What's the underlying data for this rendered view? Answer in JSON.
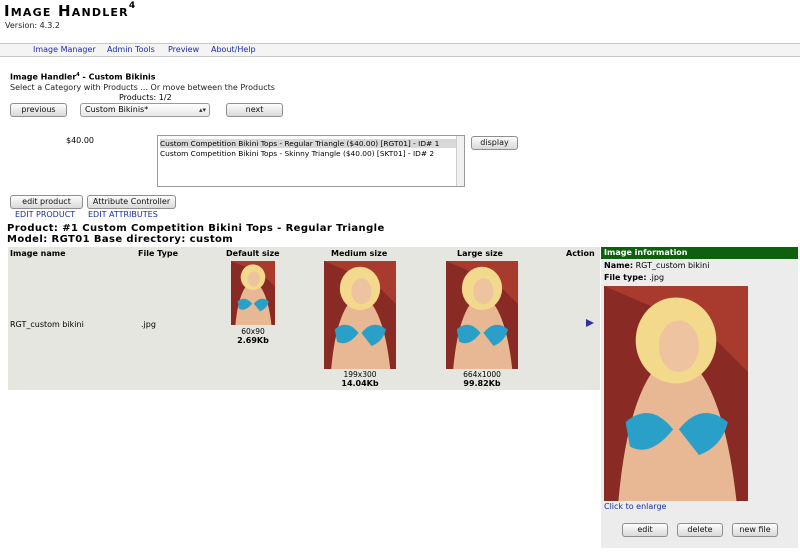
{
  "app": {
    "name": "Image Handler",
    "name_sup": "4",
    "version": "Version: 4.3.2"
  },
  "nav": [
    "Image Manager",
    "Admin Tools",
    "Preview",
    "About/Help"
  ],
  "page": {
    "title": "Image Handler",
    "title_sup": "4",
    "title_rest": " - Custom Bikinis",
    "subtitle": "Select a Category with Products ... Or move between the Products",
    "products_count": "Products: 1/2"
  },
  "controls": {
    "previous": "previous",
    "next": "next",
    "category_selected": "Custom Bikinis*",
    "price": "$40.00",
    "display": "display",
    "edit_product": "edit product",
    "attribute_controller": "Attribute Controller"
  },
  "product_list": [
    "Custom Competition Bikini Tops - Regular Triangle ($40.00) [RGT01] - ID# 1",
    "Custom Competition Bikini Tops - Skinny Triangle ($40.00) [SKT01] - ID# 2"
  ],
  "links": {
    "edit_product": "EDIT PRODUCT",
    "edit_attributes": "EDIT ATTRIBUTES"
  },
  "product": {
    "heading": "Product: #1  Custom Competition Bikini Tops - Regular Triangle",
    "model": "Model: RGT01 Base directory: custom"
  },
  "table": {
    "headers": {
      "name": "Image name",
      "type": "File Type",
      "default": "Default size",
      "medium": "Medium size",
      "large": "Large size",
      "action": "Action"
    },
    "row": {
      "name": "RGT_custom bikini",
      "type": ".jpg",
      "default_dim": "60x90",
      "default_size": "2.69Kb",
      "medium_dim": "199x300",
      "medium_size": "14.04Kb",
      "large_dim": "664x1000",
      "large_size": "99.82Kb"
    }
  },
  "info": {
    "heading": "Image information",
    "name_label": "Name:",
    "name_value": "RGT_custom bikini",
    "type_label": "File type:",
    "type_value": ".jpg",
    "enlarge": "Click to enlarge",
    "edit": "edit",
    "delete": "delete",
    "newfile": "new file"
  },
  "colors": {
    "link": "#1a2ea0",
    "info_header": "#0e5f0e",
    "table_bg": "#e6e6e0"
  }
}
